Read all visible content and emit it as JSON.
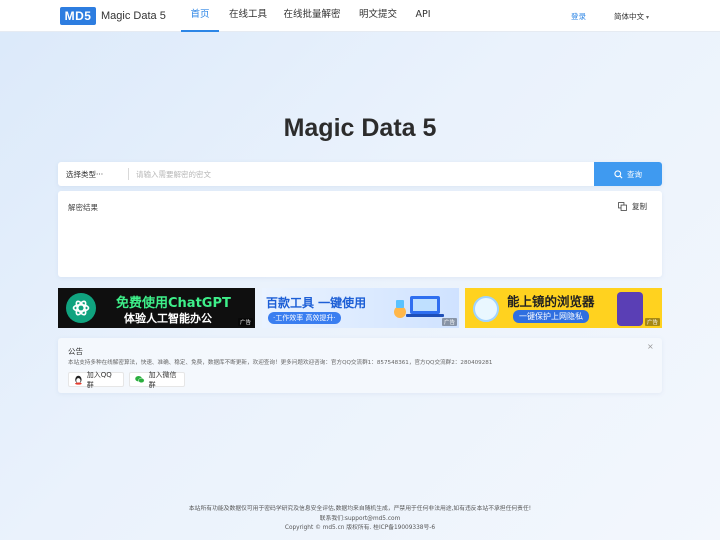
{
  "nav": {
    "logo_mark": "MD5",
    "logo_text": "Magic Data 5",
    "items": [
      {
        "label": "首页"
      },
      {
        "label": "在线工具"
      },
      {
        "label": "在线批量解密"
      },
      {
        "label": "明文提交"
      },
      {
        "label": "API"
      }
    ],
    "active_index": 0,
    "login": "登录",
    "language": "简体中文"
  },
  "main": {
    "title": "Magic Data 5",
    "search": {
      "type_select": "选择类型···",
      "placeholder": "请输入需要解密的密文",
      "value": "",
      "button_label": "查询"
    },
    "result": {
      "label": "解密结果",
      "copy_label": "复制"
    }
  },
  "banners": [
    {
      "line1": "免费使用ChatGPT",
      "line2": "体验人工智能办公",
      "ad": "广告"
    },
    {
      "line1": "百款工具 一键使用",
      "line2": "·工作效率 高效提升·",
      "ad": "广告"
    },
    {
      "line1": "能上镜的浏览器",
      "line2": "一键保护上网隐私",
      "ad": "广告"
    }
  ],
  "notice": {
    "title": "公告",
    "close": "×",
    "text": "本站支持多种在线解密算法，快速、准确、稳定、免费，数据库不断更新，欢迎查询！更多问题欢迎咨询：官方QQ交流群1：857548361，官方QQ交流群2：280409281",
    "qq_button": "加入QQ群",
    "wechat_button": "加入微信群"
  },
  "footer": {
    "line1": "本站所有功能及数据仅可用于密码学研究及信息安全评估,数据均来自随机生成，严禁用于任何非法用途,如有违反本站不承担任何责任!",
    "line2": "联系我们:support@md5.com",
    "line3": "Copyright © md5.cn 版权所有. 桂ICP备19009338号-6"
  },
  "colors": {
    "accent": "#2d86e6",
    "button": "#3f9af0"
  }
}
